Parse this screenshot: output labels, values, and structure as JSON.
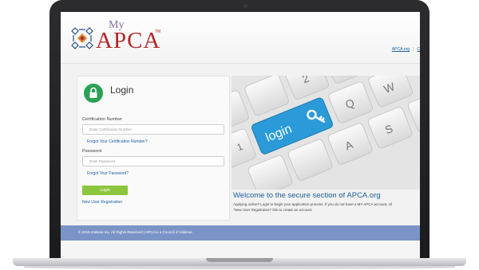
{
  "header": {
    "logo_my": "My",
    "logo_apca": "APCA",
    "logo_tm": "TM",
    "links": [
      "APCA.org",
      "|",
      "C"
    ]
  },
  "login": {
    "title": "Login",
    "cert_label": "Certification Number",
    "cert_placeholder": "Enter Certification Number",
    "forgot_cert": "Forgot Your Certification Number?",
    "password_label": "Password",
    "password_placeholder": "Enter Password",
    "forgot_password": "Forgot Your Password?",
    "submit_label": "Login",
    "new_user_link": "New User Registration"
  },
  "hero": {
    "key_label": "login",
    "key_letters": [
      "Q",
      "W",
      "A",
      "S",
      "1",
      "2",
      "~"
    ]
  },
  "main": {
    "welcome_title": "Welcome to the secure section of APCA.org",
    "intro_text": "Applying online? Login to begin your application process. If you do not have a MY APCA account, cli\n\"New User Registration\" link to create an account."
  },
  "footer": {
    "text": "© 2016 Intelese Inc. All Rights Reserved | APCA is a Council of Intelese."
  },
  "colors": {
    "accent_green": "#2aa256",
    "button_green": "#8cc63f",
    "link_blue": "#1b5ea8",
    "brand_red": "#b02a2a",
    "footer_blue": "#7b94c7",
    "key_blue": "#2a9bd8"
  }
}
